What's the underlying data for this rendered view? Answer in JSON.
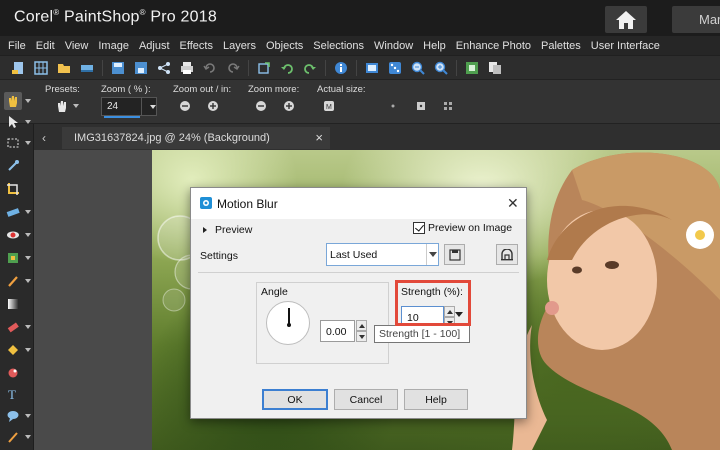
{
  "app": {
    "title_brand": "Corel",
    "title_product": "PaintShop",
    "title_suffix": "Pro 2018",
    "home_icon": "home-icon",
    "tab_manage": "Mar"
  },
  "menu": {
    "items": [
      "File",
      "Edit",
      "View",
      "Image",
      "Adjust",
      "Effects",
      "Layers",
      "Objects",
      "Selections",
      "Window",
      "Help",
      "Enhance Photo",
      "Palettes",
      "User Interface"
    ]
  },
  "toolbar": {
    "icons": [
      "new-file-icon",
      "grid-icon",
      "open-folder-icon",
      "scan-icon",
      "save-icon",
      "save-as-icon",
      "share-icon",
      "print-icon",
      "undo-icon",
      "redo-icon",
      "crop-icon",
      "rotate-left-icon",
      "rotate-right-icon",
      "info-icon",
      "fit-window-icon",
      "dice-icon",
      "zoom-out-icon",
      "zoom-in-icon",
      "full-screen-icon",
      "layers-icon"
    ]
  },
  "options": {
    "presets_label": "Presets:",
    "zoom_label": "Zoom ( % ):",
    "zoom_value": "24",
    "zoom_out_in_label": "Zoom out / in:",
    "zoom_more_label": "Zoom more:",
    "actual_size_label": "Actual size:"
  },
  "document": {
    "tab_title": "IMG31637824.jpg @  24% (Background)",
    "close_symbol": "×"
  },
  "dialog": {
    "title": "Motion Blur",
    "close_symbol": "✕",
    "preview_label": "Preview",
    "preview_on_image_label": "Preview on Image",
    "preview_on_image_checked": true,
    "settings_label": "Settings",
    "settings_value": "Last Used",
    "angle_label": "Angle",
    "angle_value": "0.00",
    "strength_label": "Strength (%):",
    "strength_value": "10",
    "tooltip": "Strength [1 - 100]",
    "ok_label": "OK",
    "cancel_label": "Cancel",
    "help_label": "Help"
  },
  "colors": {
    "highlight": "#e2493a",
    "titlebar": "#1c1c1c",
    "dialog_bg": "#f0f0f0"
  }
}
